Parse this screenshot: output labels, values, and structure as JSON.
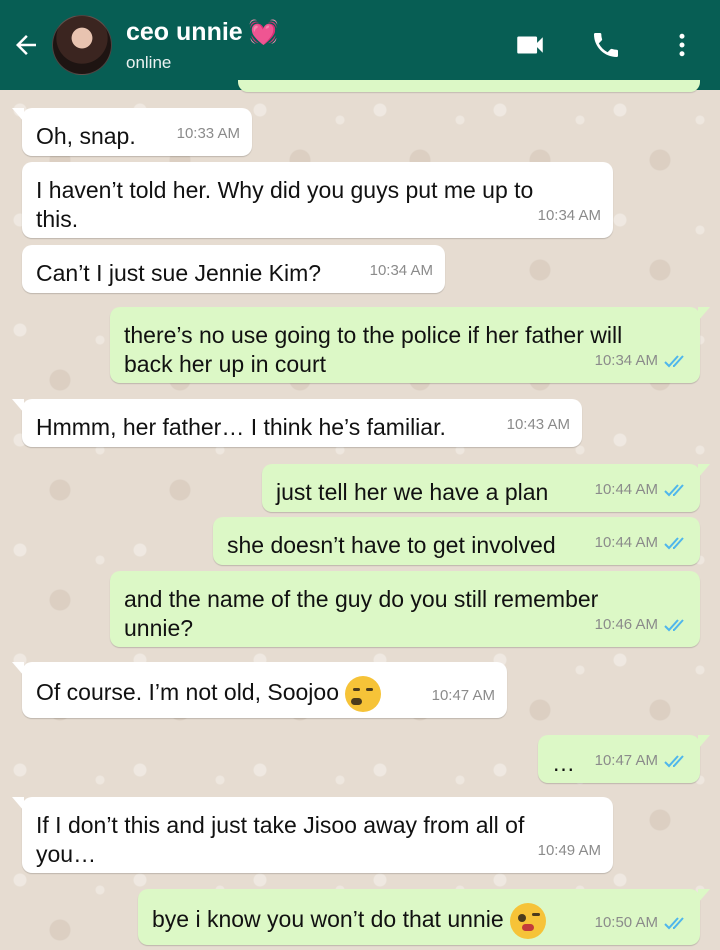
{
  "header": {
    "name": "ceo unnie",
    "name_emoji": "💓",
    "status": "online",
    "back_icon": "arrow-left-icon",
    "icons": [
      "video-call-icon",
      "phone-icon",
      "more-vert-icon"
    ]
  },
  "colors": {
    "header_bg": "#075e54",
    "incoming_bubble": "#ffffff",
    "outgoing_bubble": "#dcf8c6",
    "tick_read": "#4fb6ec"
  },
  "messages": [
    {
      "dir": "in",
      "text": "Oh, snap.",
      "time": "10:33 AM"
    },
    {
      "dir": "in",
      "text": "I haven’t told her. Why did you guys put me up to this.",
      "time": "10:34 AM"
    },
    {
      "dir": "in",
      "text": "Can’t I just sue Jennie Kim?",
      "time": "10:34 AM"
    },
    {
      "dir": "out",
      "text": "there’s no use going to the police if her father will back her up in court",
      "time": "10:34 AM",
      "read": true
    },
    {
      "dir": "in",
      "text": "Hmmm, her father… I think he’s familiar.",
      "time": "10:43 AM"
    },
    {
      "dir": "out",
      "text": "just tell her we have a plan",
      "time": "10:44 AM",
      "read": true
    },
    {
      "dir": "out",
      "text": "she doesn’t have to get involved",
      "time": "10:44 AM",
      "read": true
    },
    {
      "dir": "out",
      "text": "and the name of the guy do you still remember unnie?",
      "time": "10:46 AM",
      "read": true
    },
    {
      "dir": "in",
      "text": "Of course. I’m not old, Soojoo",
      "time": "10:47 AM",
      "emoji": "expressionless-face-icon"
    },
    {
      "dir": "out",
      "text": "…",
      "time": "10:47 AM",
      "read": true
    },
    {
      "dir": "in",
      "text": "If I don’t this and just take Jisoo away from all of you…",
      "time": "10:49 AM"
    },
    {
      "dir": "out",
      "text": "bye i know you won’t do that unnie",
      "time": "10:50 AM",
      "read": true,
      "emoji": "face-blowing-kiss-icon"
    }
  ]
}
